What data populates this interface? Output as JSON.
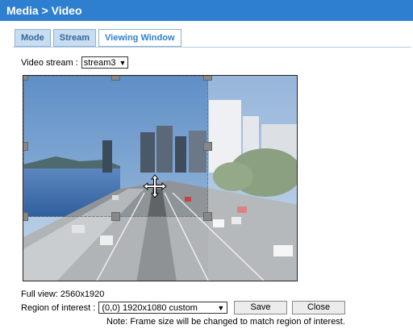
{
  "header": {
    "title": "Media  > Video"
  },
  "tabs": [
    {
      "label": "Mode"
    },
    {
      "label": "Stream"
    },
    {
      "label": "Viewing Window"
    }
  ],
  "stream": {
    "label": "Video stream :",
    "value": "stream3"
  },
  "full_view": {
    "text": "Full view: 2560x1920"
  },
  "roi": {
    "label": "Region of interest :",
    "value": "(0,0) 1920x1080 custom"
  },
  "buttons": {
    "save": "Save",
    "close": "Close"
  },
  "note": "Note: Frame size will be changed to match region of interest.",
  "icons": {
    "move": "move-cursor-icon",
    "dropdown": "chevron-down-icon"
  }
}
